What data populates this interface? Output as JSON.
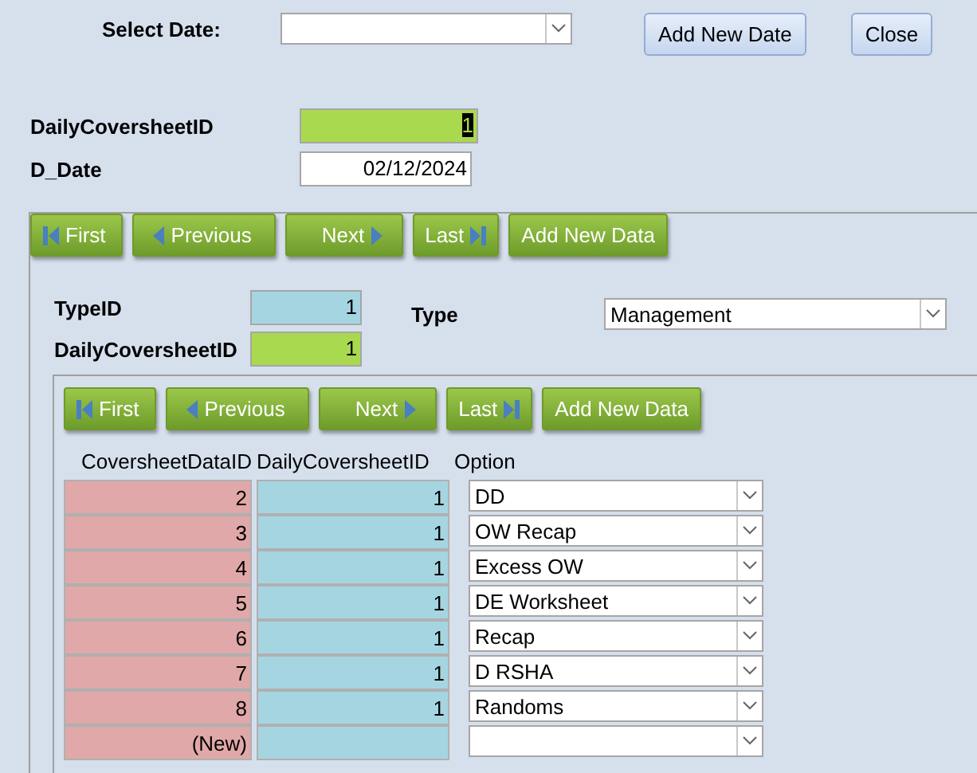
{
  "header": {
    "select_date": {
      "label": "Select Date:"
    },
    "buttons": [
      "Add New Date",
      "Close"
    ]
  },
  "main_fields": [
    {
      "label": "DailyCoversheetID",
      "value": "1",
      "kind": "key",
      "text_selected": true
    },
    {
      "label": "D_Date",
      "value": "02/12/2024",
      "kind": "plain",
      "text_selected": false
    }
  ],
  "subform": {
    "nav_buttons": [
      {
        "label": "First",
        "kind": "first"
      },
      {
        "label": "Previous",
        "kind": "previous"
      },
      {
        "label": "Next",
        "kind": "next"
      },
      {
        "label": "Last",
        "kind": "last"
      },
      {
        "label": "Add New Data",
        "kind": "add"
      }
    ],
    "fields": [
      {
        "label": "TypeID",
        "value": "1",
        "kind": "lookup"
      },
      {
        "label": "DailyCoversheetID",
        "value": "1",
        "kind": "key"
      }
    ],
    "type": {
      "label": "Type",
      "value": "Management"
    },
    "inner": {
      "nav_buttons": [
        {
          "label": "First",
          "kind": "first"
        },
        {
          "label": "Previous",
          "kind": "previous"
        },
        {
          "label": "Next",
          "kind": "next"
        },
        {
          "label": "Last",
          "kind": "last"
        },
        {
          "label": "Add New Data",
          "kind": "add"
        }
      ],
      "columns": [
        "CoversheetDataID",
        "DailyCoversheetID",
        "Option"
      ],
      "rows": [
        {
          "id": "2",
          "daily_id": "1",
          "option": "DD"
        },
        {
          "id": "3",
          "daily_id": "1",
          "option": "OW Recap"
        },
        {
          "id": "4",
          "daily_id": "1",
          "option": "Excess OW"
        },
        {
          "id": "5",
          "daily_id": "1",
          "option": "DE Worksheet"
        },
        {
          "id": "6",
          "daily_id": "1",
          "option": "Recap"
        },
        {
          "id": "7",
          "daily_id": "1",
          "option": "D RSHA"
        },
        {
          "id": "8",
          "daily_id": "1",
          "option": "Randoms"
        },
        {
          "id": "(New)"
        }
      ]
    }
  }
}
